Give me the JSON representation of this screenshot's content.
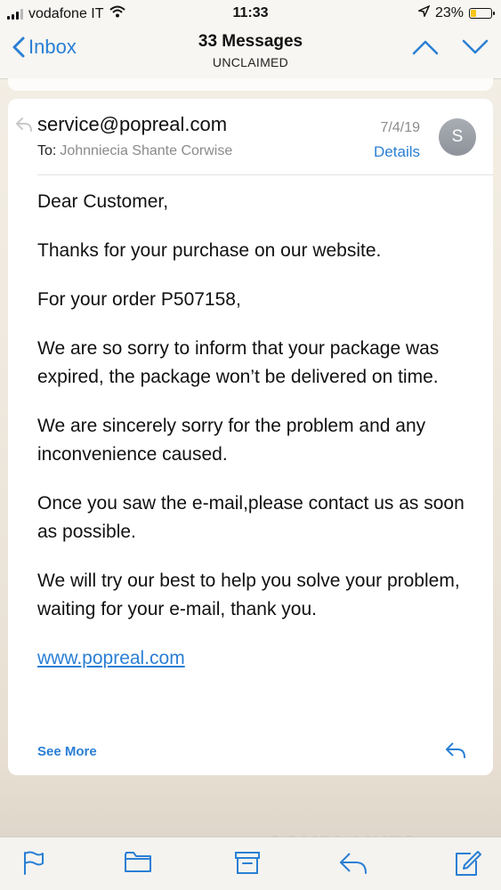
{
  "status_bar": {
    "carrier": "vodafone IT",
    "time": "11:33",
    "battery_percent": "23%",
    "battery_level": 0.23,
    "icons": [
      "signal-icon",
      "wifi-icon",
      "location-arrow-icon",
      "battery-icon"
    ]
  },
  "nav": {
    "back_label": "Inbox",
    "title": "33 Messages",
    "subtitle": "UNCLAIMED",
    "icons": [
      "chevron-left-icon",
      "chevron-up-icon",
      "chevron-down-icon"
    ]
  },
  "message": {
    "sender": "service@popreal.com",
    "to_label": "To:",
    "recipient": "Johnniecia Shante Corwise",
    "date": "7/4/19",
    "details_label": "Details",
    "avatar_initial": "S",
    "body": [
      "Dear Customer,",
      "Thanks for your purchase on our website.",
      "For your order P507158,",
      "We are so sorry to inform that your package was expired, the package won’t be delivered on time.",
      "We are sincerely sorry for the problem and any inconvenience caused.",
      "Once you saw the e-mail,please contact us as soon as possible.",
      "We will try our best to help you solve your problem, waiting for your e-mail, thank you."
    ],
    "link": "www.popreal.com",
    "see_more_label": "See More"
  },
  "toolbar": {
    "icons": [
      "flag-icon",
      "folder-icon",
      "archive-icon",
      "reply-icon",
      "compose-icon"
    ]
  },
  "colors": {
    "accent": "#2a7fd4",
    "battery": "#f5c518"
  }
}
